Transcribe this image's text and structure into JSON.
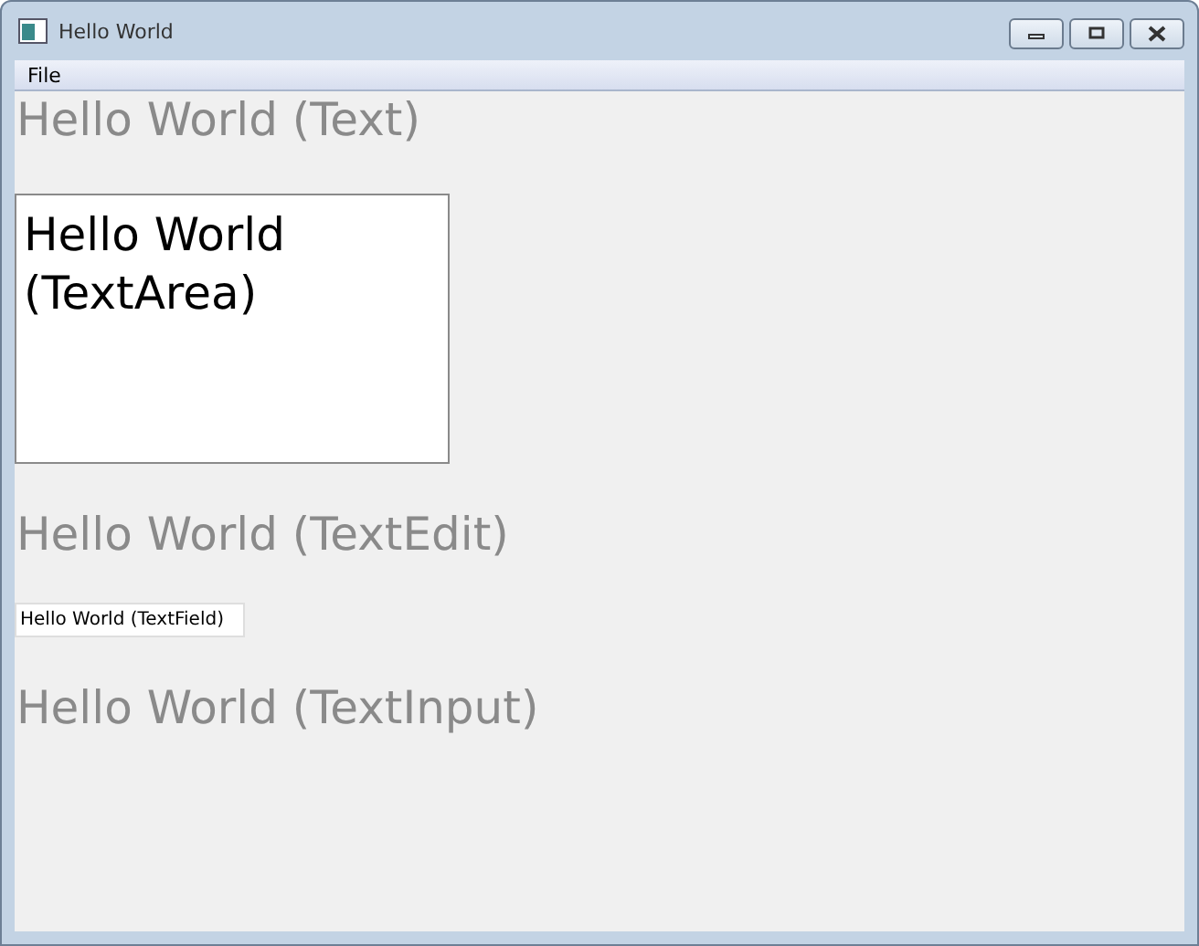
{
  "window": {
    "title": "Hello World"
  },
  "menu": [
    "File"
  ],
  "text": "Hello World (Text)",
  "text_area": {
    "value": "Hello World\n(TextArea)"
  },
  "text_edit": "Hello World (TextEdit)",
  "text_field": {
    "value": "Hello World (TextField)"
  },
  "text_input": "Hello World (TextInput)"
}
